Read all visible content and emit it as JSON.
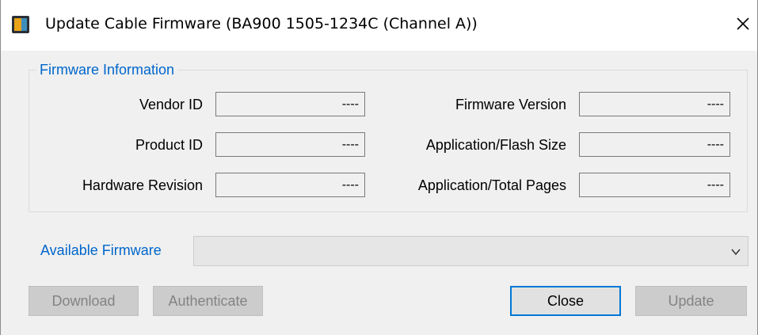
{
  "window": {
    "title": "Update Cable Firmware (BA900 1505-1234C (Channel A))",
    "icon": "app-icon"
  },
  "firmware_info": {
    "group_title": "Firmware Information",
    "vendor_id": {
      "label": "Vendor ID",
      "value": "----"
    },
    "product_id": {
      "label": "Product ID",
      "value": "----"
    },
    "hardware_revision": {
      "label": "Hardware Revision",
      "value": "----"
    },
    "firmware_version": {
      "label": "Firmware Version",
      "value": "----"
    },
    "app_flash_size": {
      "label": "Application/Flash Size",
      "value": "----"
    },
    "app_total_pages": {
      "label": "Application/Total Pages",
      "value": "----"
    }
  },
  "available_firmware": {
    "label": "Available Firmware",
    "selected": ""
  },
  "buttons": {
    "download": "Download",
    "authenticate": "Authenticate",
    "close": "Close",
    "update": "Update"
  },
  "colors": {
    "accent_label": "#0066cc",
    "focus_border": "#0078d7",
    "disabled_bg": "#cccccc",
    "disabled_text": "#838383"
  }
}
